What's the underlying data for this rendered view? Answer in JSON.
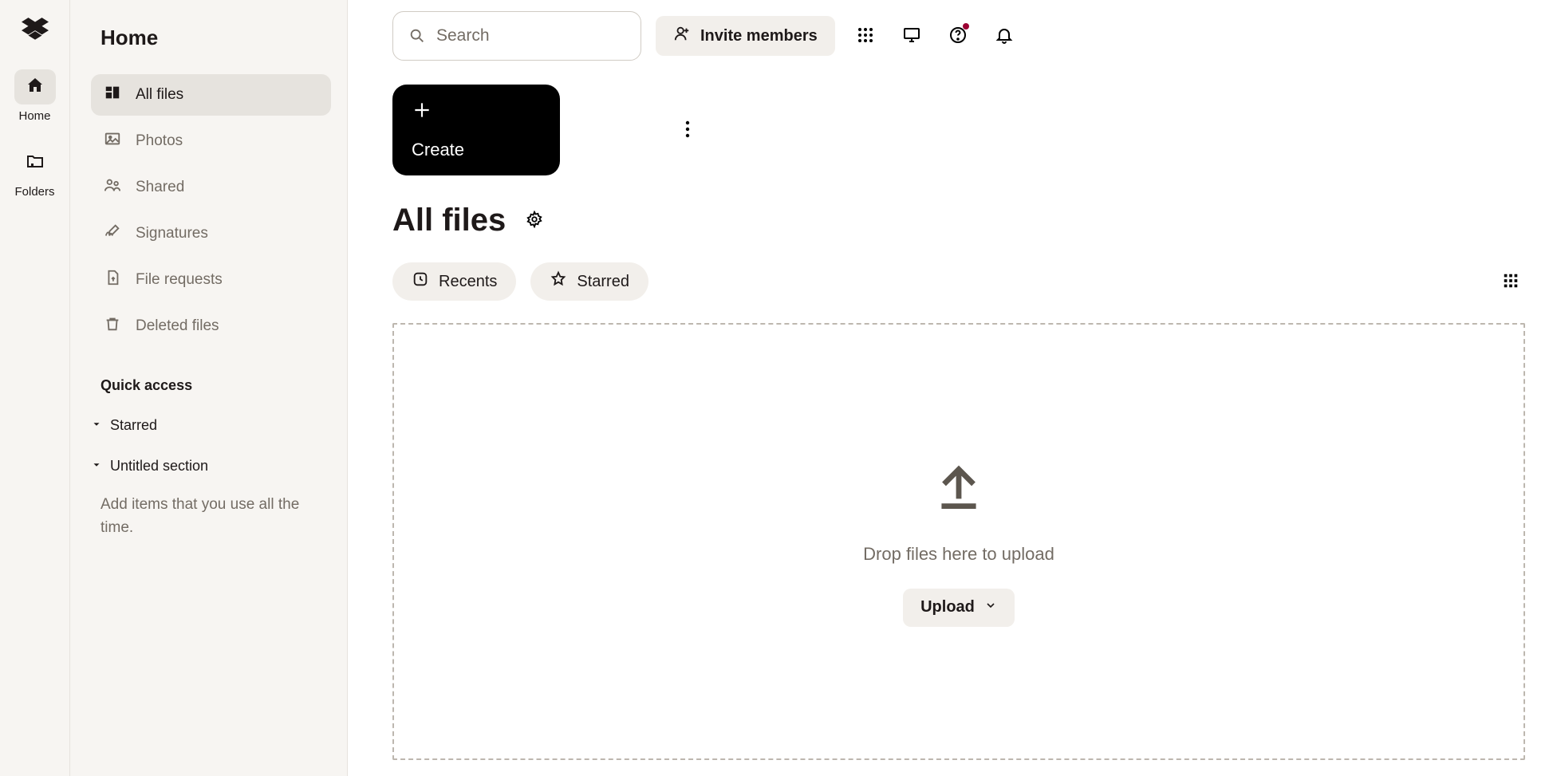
{
  "rail": {
    "items": [
      {
        "label": "Home"
      },
      {
        "label": "Folders"
      }
    ]
  },
  "sidebar": {
    "title": "Home",
    "nav": [
      {
        "label": "All files",
        "active": true
      },
      {
        "label": "Photos"
      },
      {
        "label": "Shared"
      },
      {
        "label": "Signatures"
      },
      {
        "label": "File requests"
      },
      {
        "label": "Deleted files"
      }
    ],
    "quick_access_label": "Quick access",
    "sections": [
      {
        "label": "Starred"
      },
      {
        "label": "Untitled section"
      }
    ],
    "hint": "Add items that you use all the time."
  },
  "topbar": {
    "search_placeholder": "Search",
    "invite_label": "Invite members"
  },
  "main": {
    "create_label": "Create",
    "page_title": "All files",
    "chips": [
      {
        "label": "Recents"
      },
      {
        "label": "Starred"
      }
    ],
    "dropzone_text": "Drop files here to upload",
    "upload_label": "Upload"
  }
}
